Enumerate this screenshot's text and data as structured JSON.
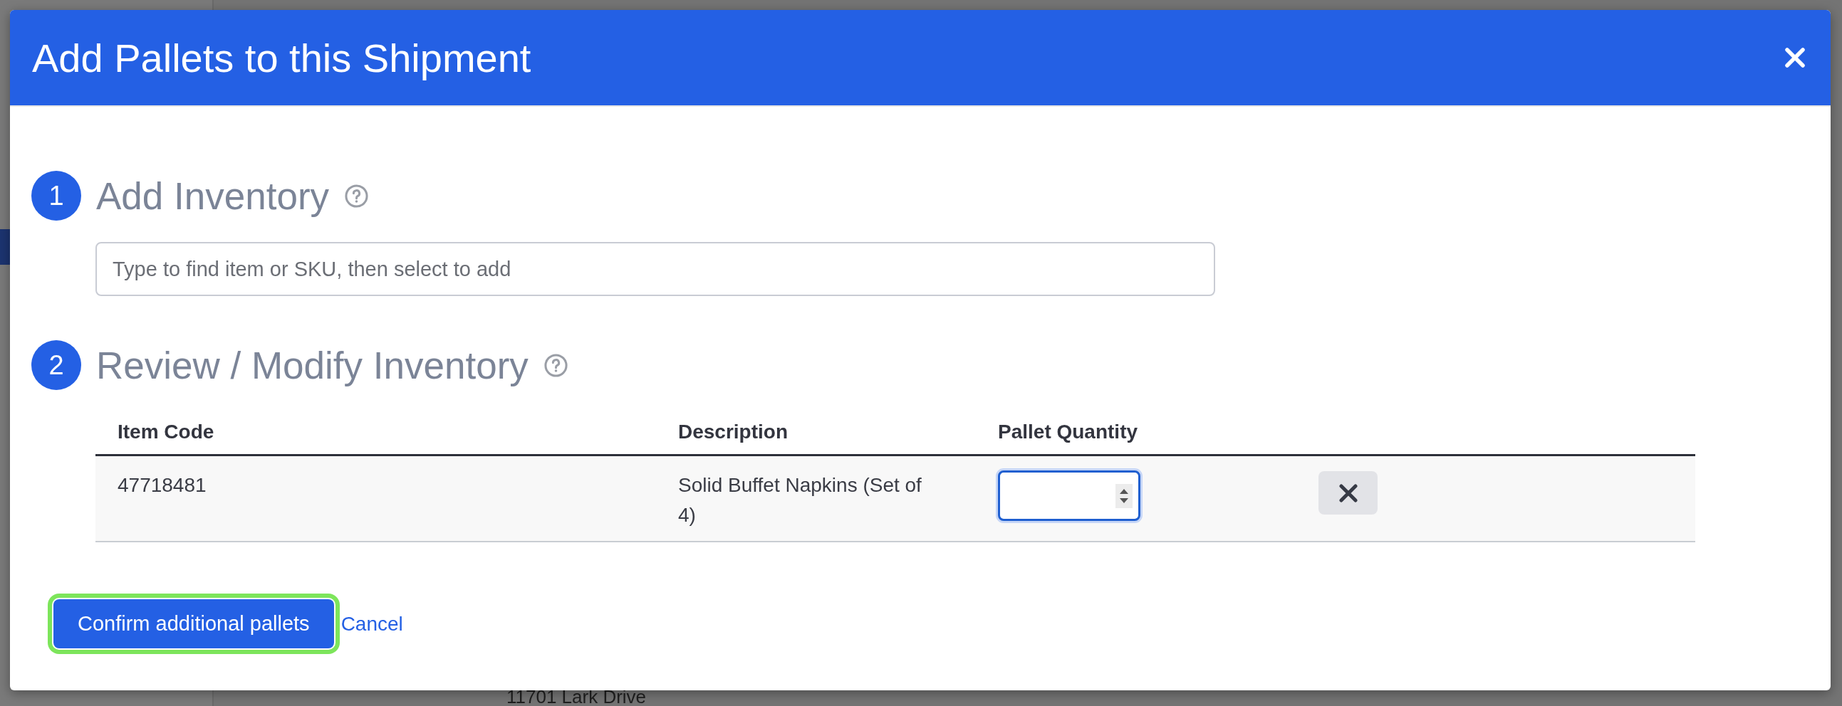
{
  "background": {
    "address": "11701 Lark Drive"
  },
  "dialog": {
    "title": "Add Pallets to this Shipment"
  },
  "steps": [
    {
      "number": "1",
      "title": "Add Inventory",
      "kind": "search",
      "search": {
        "placeholder": "Type to find item or SKU, then select to add"
      }
    },
    {
      "number": "2",
      "title": "Review / Modify Inventory",
      "kind": "table",
      "table": {
        "columns": [
          "Item Code",
          "Description",
          "Pallet Quantity"
        ],
        "rows": [
          {
            "item_code": "47718481",
            "description": "Solid Buffet Napkins (Set of 4)",
            "quantity_focused": true
          }
        ]
      }
    }
  ],
  "footer": {
    "confirm": {
      "label": "Confirm additional pallets",
      "highlighted": true
    },
    "cancel": "Cancel"
  }
}
